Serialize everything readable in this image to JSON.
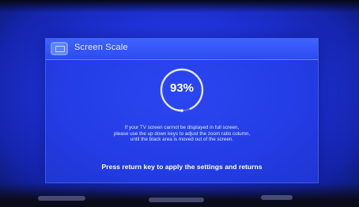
{
  "dialog": {
    "title": "Screen Scale",
    "title_icon": "screen-icon",
    "scale": {
      "value": 93,
      "label": "93%"
    },
    "description_lines": [
      "If your TV screen cannot be displayed in full screen,",
      "please use the up down keys to adjust the zoom ratio column,",
      "until the black area is moved out of the screen."
    ],
    "hint": "Press return key to apply the settings and returns"
  },
  "colors": {
    "background": "#1f33d9",
    "dialog": "#2846f0",
    "title_bar": "#3f63ff",
    "text": "#ffffff"
  }
}
